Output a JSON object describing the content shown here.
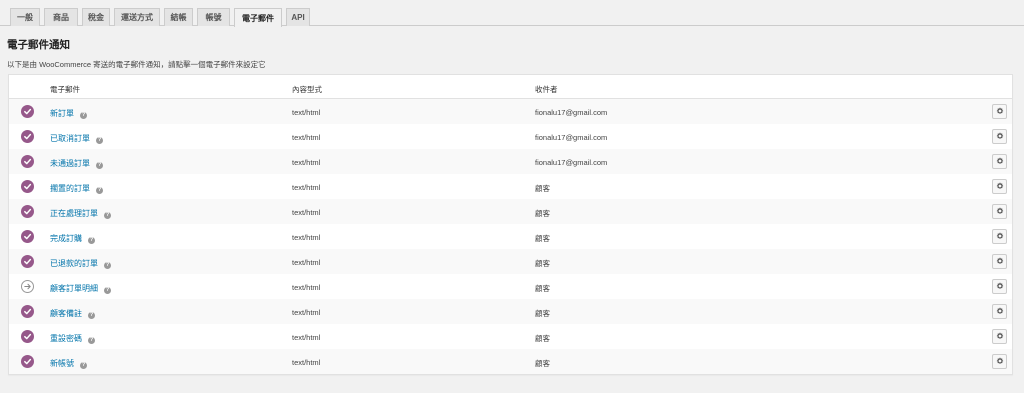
{
  "tabs": [
    {
      "label": "一般"
    },
    {
      "label": "商品"
    },
    {
      "label": "稅金"
    },
    {
      "label": "運送方式"
    },
    {
      "label": "結帳"
    },
    {
      "label": "帳號"
    },
    {
      "label": "電子郵件",
      "active": true
    },
    {
      "label": "API"
    }
  ],
  "section": {
    "title": "電子郵件通知",
    "description": "以下是由 WooCommerce 寄送的電子郵件通知，請點擊一個電子郵件來設定它"
  },
  "table": {
    "headers": {
      "email": "電子郵件",
      "content_type": "內容型式",
      "recipient": "收件者"
    },
    "help_glyph": "?",
    "rows": [
      {
        "name": "新訂單",
        "content_type": "text/html",
        "recipient": "fionalu17@gmail.com",
        "status": "enabled"
      },
      {
        "name": "已取消訂單",
        "content_type": "text/html",
        "recipient": "fionalu17@gmail.com",
        "status": "enabled"
      },
      {
        "name": "未通過訂單",
        "content_type": "text/html",
        "recipient": "fionalu17@gmail.com",
        "status": "enabled"
      },
      {
        "name": "擱置的訂單",
        "content_type": "text/html",
        "recipient": "顧客",
        "status": "enabled"
      },
      {
        "name": "正在處理訂單",
        "content_type": "text/html",
        "recipient": "顧客",
        "status": "enabled"
      },
      {
        "name": "完成訂購",
        "content_type": "text/html",
        "recipient": "顧客",
        "status": "enabled"
      },
      {
        "name": "已退款的訂單",
        "content_type": "text/html",
        "recipient": "顧客",
        "status": "enabled"
      },
      {
        "name": "顧客訂單明細",
        "content_type": "text/html",
        "recipient": "顧客",
        "status": "manual"
      },
      {
        "name": "顧客備註",
        "content_type": "text/html",
        "recipient": "顧客",
        "status": "enabled"
      },
      {
        "name": "重設密碼",
        "content_type": "text/html",
        "recipient": "顧客",
        "status": "enabled"
      },
      {
        "name": "新帳號",
        "content_type": "text/html",
        "recipient": "顧客",
        "status": "enabled"
      }
    ]
  },
  "icons": {
    "enabled": "check-circle-icon",
    "manual": "arrow-right-circle-icon",
    "manage": "gear-icon"
  },
  "colors": {
    "enabled_status": "#96588a",
    "link": "#0073aa"
  }
}
